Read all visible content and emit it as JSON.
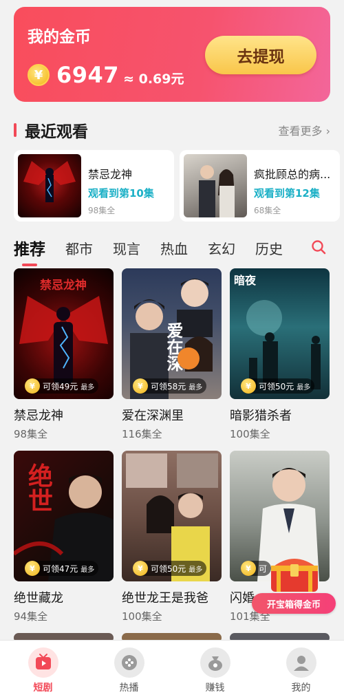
{
  "coins": {
    "title": "我的金币",
    "coin_symbol": "¥",
    "amount": "6947",
    "approx": "≈ 0.69元",
    "withdraw_label": "去提现"
  },
  "recent": {
    "title": "最近观看",
    "see_more": "查看更多 ›",
    "items": [
      {
        "title": "禁忌龙神",
        "progress": "观看到第10集",
        "episodes": "98集全"
      },
      {
        "title": "疯批顾总的病...",
        "progress": "观看到第12集",
        "episodes": "68集全"
      }
    ]
  },
  "tabs": [
    {
      "label": "推荐",
      "active": true
    },
    {
      "label": "都市"
    },
    {
      "label": "现言"
    },
    {
      "label": "热血"
    },
    {
      "label": "玄幻"
    },
    {
      "label": "历史"
    }
  ],
  "dramas": [
    {
      "title": "禁忌龙神",
      "episodes": "98集全",
      "reward": "可领49元",
      "reward_max": "最多",
      "poster_text": "禁忌龙神"
    },
    {
      "title": "爱在深渊里",
      "episodes": "116集全",
      "reward": "可领58元",
      "reward_max": "最多",
      "poster_text": "爱在深"
    },
    {
      "title": "暗影猎杀者",
      "episodes": "100集全",
      "reward": "可领50元",
      "reward_max": "最多",
      "poster_text": "暗夜"
    },
    {
      "title": "绝世藏龙",
      "episodes": "94集全",
      "reward": "可领47元",
      "reward_max": "最多",
      "poster_text": "绝世"
    },
    {
      "title": "绝世龙王是我爸",
      "episodes": "100集全",
      "reward": "可领50元",
      "reward_max": "最多",
      "poster_text": ""
    },
    {
      "title": "闪婚",
      "episodes": "101集全",
      "reward": "可",
      "reward_max": "",
      "poster_text": ""
    }
  ],
  "treasure": {
    "label": "开宝箱得金币"
  },
  "nav": [
    {
      "label": "短剧",
      "icon": "play-icon",
      "active": true
    },
    {
      "label": "热播",
      "icon": "hot-icon"
    },
    {
      "label": "赚钱",
      "icon": "money-bag-icon"
    },
    {
      "label": "我的",
      "icon": "profile-icon"
    }
  ],
  "colors": {
    "accent": "#f24957",
    "teal": "#1bb0c6",
    "gold": "#f9c64a"
  }
}
